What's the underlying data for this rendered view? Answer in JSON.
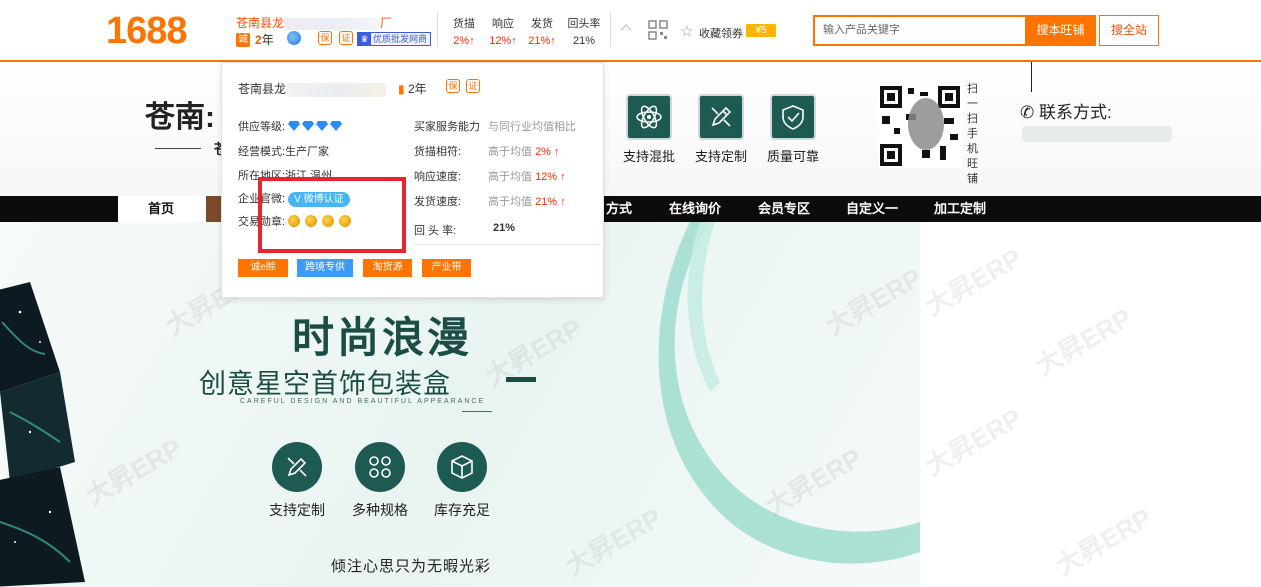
{
  "top": {
    "logo": "1688",
    "shop_name_start": "苍南县龙",
    "shop_name_end": "厂",
    "cheng_badge": "诚",
    "years_num": "2",
    "years_unit": "年",
    "pill_label": "优质批发网商",
    "metrics": [
      {
        "label": "货描",
        "value": "2%↑"
      },
      {
        "label": "响应",
        "value": "12%↑"
      },
      {
        "label": "发货",
        "value": "21%↑"
      },
      {
        "label": "回头率",
        "value": "21%"
      }
    ],
    "fav_label": "收藏领券",
    "coupon_label": "¥5",
    "search_placeholder": "输入产品关键字",
    "search_shop_button": "搜本旺铺",
    "search_all_button": "搜全站"
  },
  "header": {
    "title": "苍南:",
    "sub": "苍",
    "features": [
      {
        "label": "支持混批",
        "icon": "atom-icon"
      },
      {
        "label": "支持定制",
        "icon": "pencil-icon"
      },
      {
        "label": "质量可靠",
        "icon": "shield-check-icon"
      }
    ],
    "scan_text": "扫一扫手机旺铺",
    "contact_label": "联系方式:"
  },
  "nav": {
    "items": [
      "首页",
      "方式",
      "在线询价",
      "会员专区",
      "自定义一",
      "加工定制"
    ]
  },
  "popup": {
    "name_start": "苍南县龙",
    "years_num": "2",
    "years_unit": "年",
    "left_rows": [
      {
        "key": "供应等级:",
        "value": ""
      },
      {
        "key": "经营模式:",
        "value": "生产厂家"
      },
      {
        "key": "所在地区:",
        "value": "浙江 温州"
      },
      {
        "key": "企业官微:",
        "value": "微博认证"
      },
      {
        "key": "交易勋章:",
        "value": ""
      }
    ],
    "right_header": {
      "key": "买家服务能力",
      "value": "与同行业均值相比"
    },
    "right_rows": [
      {
        "key": "货描相符:",
        "value_prefix": "高于均值",
        "value_num": "2%",
        "arrow": "↑"
      },
      {
        "key": "响应速度:",
        "value_prefix": "高于均值",
        "value_num": "12%",
        "arrow": "↑"
      },
      {
        "key": "发货速度:",
        "value_prefix": "高于均值",
        "value_num": "21%",
        "arrow": "↑"
      }
    ],
    "repeat_key": "回 头 率:",
    "repeat_value": "21%",
    "buttons": [
      {
        "label": "诚e赊",
        "color": "#ff7300"
      },
      {
        "label": "跨境专供",
        "color": "#3d9bf5"
      },
      {
        "label": "淘货源",
        "color": "#ff7300"
      },
      {
        "label": "产业带",
        "color": "#ff7300"
      }
    ]
  },
  "banner": {
    "title": "时尚浪漫",
    "subtitle": "创意星空首饰包装盒",
    "english": "CAREFUL DESIGN AND BEAUTIFUL APPEARANCE",
    "features": [
      {
        "label": "支持定制",
        "icon": "pencil-ruler-icon"
      },
      {
        "label": "多种规格",
        "icon": "grid-icon"
      },
      {
        "label": "库存充足",
        "icon": "box-icon"
      }
    ],
    "tagline": "倾注心思只为无暇光彩",
    "watermark": "大昇ERP"
  },
  "colors": {
    "brand": "#ff7300",
    "accent_green": "#1d5a52",
    "highlight_red": "#e8242c"
  }
}
